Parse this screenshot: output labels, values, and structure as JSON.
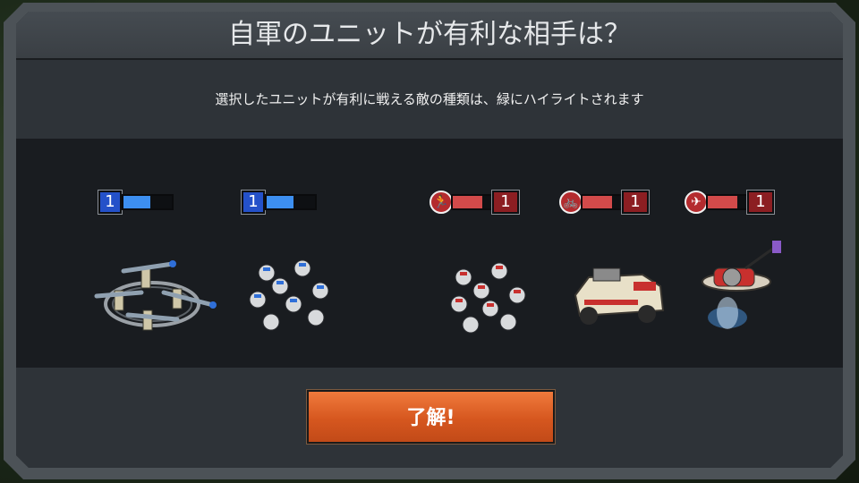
{
  "dialog": {
    "title": "自軍のユニットが有利な相手は？",
    "subtitle": "選択したユニットが有利に戦える敵の種類は、緑にハイライトされます",
    "ok_label": "了解!"
  },
  "units": [
    {
      "name": "rocket-infantry",
      "side": "ally",
      "level": "1",
      "fill": 0.55,
      "icon": "rocket-soldiers"
    },
    {
      "name": "rifle-infantry",
      "side": "ally",
      "level": "1",
      "fill": 0.55,
      "icon": "rifle-soldiers"
    },
    {
      "name": "enemy-infantry",
      "side": "enemy",
      "level": "1",
      "fill": 0.75,
      "type_icon": "🏃",
      "type_icon_name": "running-man-icon"
    },
    {
      "name": "enemy-vehicle",
      "side": "enemy",
      "level": "1",
      "fill": 0.75,
      "type_icon": "🚲",
      "type_icon_name": "vehicle-icon"
    },
    {
      "name": "enemy-air",
      "side": "enemy",
      "level": "1",
      "fill": 0.75,
      "type_icon": "✈",
      "type_icon_name": "airplane-icon"
    }
  ],
  "colors": {
    "ally_badge": "#2451c9",
    "ally_bar": "#3d8ff0",
    "enemy_badge": "#8c1e22",
    "enemy_bar": "#d24a4a",
    "button": "#e0622a"
  }
}
